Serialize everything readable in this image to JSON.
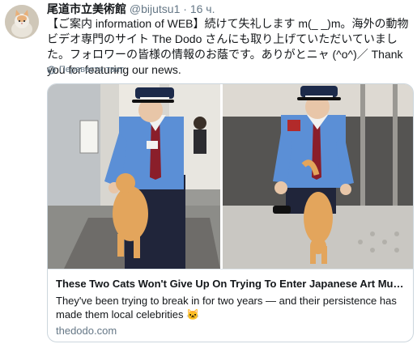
{
  "author": {
    "name": "尾道市立美術館",
    "handle": "@bijutsu1",
    "separator": "·",
    "time": "16 ч."
  },
  "tweet_text": "【ご案内 information of WEB】続けて失礼します m(_ _)m。海外の動物ビデオ専門のサイト The Dodo さんにも取り上げていただいていました。フォロワーの皆様の情報のお蔭です。ありがとニャ (^o^)／ Thank you for featuring our news.",
  "translate_label": "Перевести твит",
  "card": {
    "title": "These Two Cats Won't Give Up On Trying To Enter Japanese Art Museum",
    "description": "They've been trying to break in for two years — and their persistence has made them local celebrities 🐱",
    "domain": "thedodo.com"
  },
  "icons": {
    "translate": "globe-icon",
    "avatar": "cat-avatar"
  },
  "colors": {
    "secondary_text": "#657786",
    "border": "#ccd6dd",
    "uniform": "#5b8fd6",
    "cap": "#1c2a4a",
    "cat": "#e3a55c"
  }
}
